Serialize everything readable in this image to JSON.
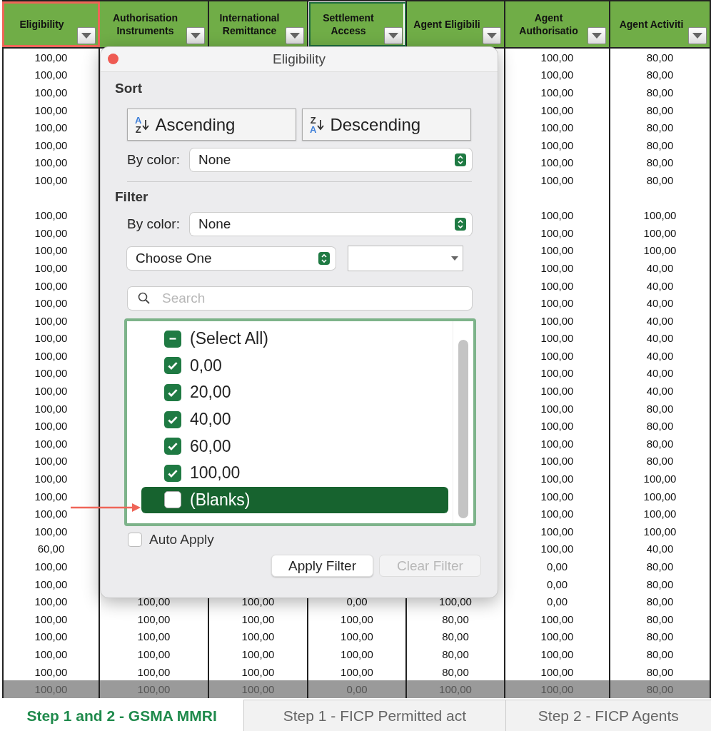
{
  "columns": [
    {
      "header": "Eligibility",
      "selected": false,
      "highlighted": true
    },
    {
      "header": "Authorisation Instruments",
      "selected": false,
      "highlighted": false
    },
    {
      "header": "International Remittance",
      "selected": false,
      "highlighted": false
    },
    {
      "header": "Settlement Access",
      "selected": true,
      "highlighted": false
    },
    {
      "header": "Agent Eligibili",
      "selected": false,
      "highlighted": false
    },
    {
      "header": "Agent Authorisatio",
      "selected": false,
      "highlighted": false
    },
    {
      "header": "Agent Activiti",
      "selected": false,
      "highlighted": false
    }
  ],
  "rows": [
    {
      "shaded": false,
      "cells": [
        "100,00",
        null,
        null,
        null,
        null,
        "100,00",
        "80,00"
      ]
    },
    {
      "shaded": false,
      "cells": [
        "100,00",
        null,
        null,
        null,
        null,
        "100,00",
        "80,00"
      ]
    },
    {
      "shaded": false,
      "cells": [
        "100,00",
        null,
        null,
        null,
        null,
        "100,00",
        "80,00"
      ]
    },
    {
      "shaded": false,
      "cells": [
        "100,00",
        null,
        null,
        null,
        null,
        "100,00",
        "80,00"
      ]
    },
    {
      "shaded": false,
      "cells": [
        "100,00",
        null,
        null,
        null,
        null,
        "100,00",
        "80,00"
      ]
    },
    {
      "shaded": false,
      "cells": [
        "100,00",
        null,
        null,
        null,
        null,
        "100,00",
        "80,00"
      ]
    },
    {
      "shaded": false,
      "cells": [
        "100,00",
        null,
        null,
        null,
        null,
        "100,00",
        "80,00"
      ]
    },
    {
      "shaded": false,
      "cells": [
        "100,00",
        null,
        null,
        null,
        null,
        "100,00",
        "80,00"
      ]
    },
    {
      "shaded": false,
      "cells": [
        null,
        null,
        null,
        null,
        null,
        null,
        null
      ]
    },
    {
      "shaded": false,
      "cells": [
        "100,00",
        null,
        null,
        null,
        null,
        "100,00",
        "100,00"
      ]
    },
    {
      "shaded": false,
      "cells": [
        "100,00",
        null,
        null,
        null,
        null,
        "100,00",
        "100,00"
      ]
    },
    {
      "shaded": false,
      "cells": [
        "100,00",
        null,
        null,
        null,
        null,
        "100,00",
        "100,00"
      ]
    },
    {
      "shaded": false,
      "cells": [
        "100,00",
        null,
        null,
        null,
        null,
        "100,00",
        "40,00"
      ]
    },
    {
      "shaded": false,
      "cells": [
        "100,00",
        null,
        null,
        null,
        null,
        "100,00",
        "40,00"
      ]
    },
    {
      "shaded": false,
      "cells": [
        "100,00",
        null,
        null,
        null,
        null,
        "100,00",
        "40,00"
      ]
    },
    {
      "shaded": false,
      "cells": [
        "100,00",
        null,
        null,
        null,
        null,
        "100,00",
        "40,00"
      ]
    },
    {
      "shaded": false,
      "cells": [
        "100,00",
        null,
        null,
        null,
        null,
        "100,00",
        "40,00"
      ]
    },
    {
      "shaded": false,
      "cells": [
        "100,00",
        null,
        null,
        null,
        null,
        "100,00",
        "40,00"
      ]
    },
    {
      "shaded": false,
      "cells": [
        "100,00",
        null,
        null,
        null,
        null,
        "100,00",
        "40,00"
      ]
    },
    {
      "shaded": false,
      "cells": [
        "100,00",
        null,
        null,
        null,
        null,
        "100,00",
        "40,00"
      ]
    },
    {
      "shaded": false,
      "cells": [
        "100,00",
        null,
        null,
        null,
        null,
        "100,00",
        "80,00"
      ]
    },
    {
      "shaded": false,
      "cells": [
        "100,00",
        null,
        null,
        null,
        null,
        "100,00",
        "80,00"
      ]
    },
    {
      "shaded": false,
      "cells": [
        "100,00",
        null,
        null,
        null,
        null,
        "100,00",
        "80,00"
      ]
    },
    {
      "shaded": false,
      "cells": [
        "100,00",
        null,
        null,
        null,
        null,
        "100,00",
        "80,00"
      ]
    },
    {
      "shaded": false,
      "cells": [
        "100,00",
        null,
        null,
        null,
        null,
        "100,00",
        "100,00"
      ]
    },
    {
      "shaded": false,
      "cells": [
        "100,00",
        null,
        null,
        null,
        null,
        "100,00",
        "100,00"
      ]
    },
    {
      "shaded": false,
      "cells": [
        "100,00",
        null,
        null,
        null,
        null,
        "100,00",
        "100,00"
      ]
    },
    {
      "shaded": false,
      "cells": [
        "100,00",
        null,
        null,
        null,
        null,
        "100,00",
        "100,00"
      ]
    },
    {
      "shaded": false,
      "cells": [
        "60,00",
        null,
        null,
        null,
        null,
        "100,00",
        "40,00"
      ]
    },
    {
      "shaded": false,
      "cells": [
        "100,00",
        null,
        null,
        null,
        null,
        "0,00",
        "80,00"
      ]
    },
    {
      "shaded": false,
      "cells": [
        "100,00",
        null,
        null,
        null,
        null,
        "0,00",
        "80,00"
      ]
    },
    {
      "shaded": false,
      "cells": [
        "100,00",
        "100,00",
        "100,00",
        "0,00",
        "100,00",
        "0,00",
        "80,00"
      ]
    },
    {
      "shaded": false,
      "cells": [
        "100,00",
        "100,00",
        "100,00",
        "100,00",
        "80,00",
        "100,00",
        "80,00"
      ]
    },
    {
      "shaded": false,
      "cells": [
        "100,00",
        "100,00",
        "100,00",
        "100,00",
        "80,00",
        "100,00",
        "80,00"
      ]
    },
    {
      "shaded": false,
      "cells": [
        "100,00",
        "100,00",
        "100,00",
        "100,00",
        "80,00",
        "100,00",
        "80,00"
      ]
    },
    {
      "shaded": false,
      "cells": [
        "100,00",
        "100,00",
        "100,00",
        "100,00",
        "80,00",
        "100,00",
        "80,00"
      ]
    },
    {
      "shaded": true,
      "cells": [
        "100,00",
        "100,00",
        "100,00",
        "0,00",
        "100,00",
        "100,00",
        "80,00"
      ]
    }
  ],
  "filter_popup": {
    "title": "Eligibility",
    "sort_label": "Sort",
    "sort_buttons": [
      {
        "label": "Ascending",
        "letters": [
          {
            "char": "A",
            "color": "#3b7dd8"
          },
          {
            "char": "Z",
            "color": "#333333"
          }
        ]
      },
      {
        "label": "Descending",
        "letters": [
          {
            "char": "Z",
            "color": "#333333"
          },
          {
            "char": "A",
            "color": "#3b7dd8"
          }
        ]
      }
    ],
    "sort_by_color": {
      "label": "By color:",
      "value": "None"
    },
    "filter_label": "Filter",
    "filter_by_color": {
      "label": "By color:",
      "value": "None"
    },
    "condition": {
      "value": "Choose One"
    },
    "search": {
      "placeholder": "Search"
    },
    "select_all": {
      "label": "(Select All)",
      "mixed": true
    },
    "values": [
      {
        "label": "0,00",
        "checked": true,
        "selected": false
      },
      {
        "label": "20,00",
        "checked": true,
        "selected": false
      },
      {
        "label": "40,00",
        "checked": true,
        "selected": false
      },
      {
        "label": "60,00",
        "checked": true,
        "selected": false
      },
      {
        "label": "100,00",
        "checked": true,
        "selected": false
      },
      {
        "label": "(Blanks)",
        "checked": false,
        "selected": true
      }
    ],
    "auto_apply": {
      "label": "Auto Apply",
      "checked": false
    },
    "buttons": [
      {
        "label": "Apply Filter",
        "disabled": false
      },
      {
        "label": "Clear Filter",
        "disabled": true
      }
    ]
  },
  "sheet_tabs": [
    {
      "label": "Step 1 and 2 - GSMA MMRI",
      "selected": true
    },
    {
      "label": "Step 1 - FICP Permitted act",
      "selected": false
    },
    {
      "label": "Step 2 - FICP Agents",
      "selected": false
    }
  ]
}
